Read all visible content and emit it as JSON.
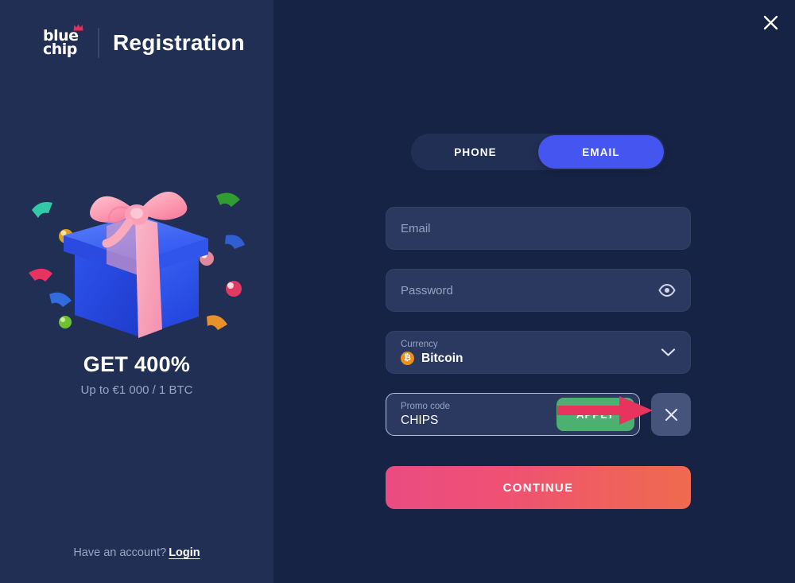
{
  "brand": {
    "logo_line_1": "blue",
    "logo_line_2": "chip",
    "logo_icon": "crown-icon",
    "title": "Registration"
  },
  "promo_panel": {
    "bonus_title": "GET 400%",
    "bonus_subtitle": "Up to €1 000 / 1 BTC",
    "illustration_icon": "gift-box-illustration",
    "account_prompt": "Have an account?",
    "login_label": "Login"
  },
  "header": {
    "close_icon": "close-icon"
  },
  "form": {
    "tabs": [
      {
        "label": "PHONE",
        "active": false
      },
      {
        "label": "EMAIL",
        "active": true
      }
    ],
    "email": {
      "placeholder": "Email",
      "value": ""
    },
    "password": {
      "placeholder": "Password",
      "value": "",
      "toggle_icon": "eye-icon"
    },
    "currency": {
      "label": "Currency",
      "value": "Bitcoin",
      "coin_symbol": "₿",
      "coin_icon": "bitcoin-icon",
      "chevron_icon": "chevron-down-icon"
    },
    "promo": {
      "label": "Promo code",
      "value": "CHIPS",
      "apply_label": "APPLY",
      "clear_icon": "close-icon"
    },
    "submit_label": "CONTINUE"
  },
  "annotation": {
    "arrow_icon": "arrow-right-annotation",
    "color": "#e8335f"
  },
  "colors": {
    "left_panel_bg": "#222f54",
    "right_panel_bg": "#172344",
    "field_bg": "#2b3860",
    "tab_active": "#4455f0",
    "apply_green": "#4cb071",
    "continue_gradient_from": "#ea4c82",
    "continue_gradient_to": "#ef6a4f",
    "bitcoin_orange": "#ef8e19",
    "muted_text": "#98a2c0"
  }
}
